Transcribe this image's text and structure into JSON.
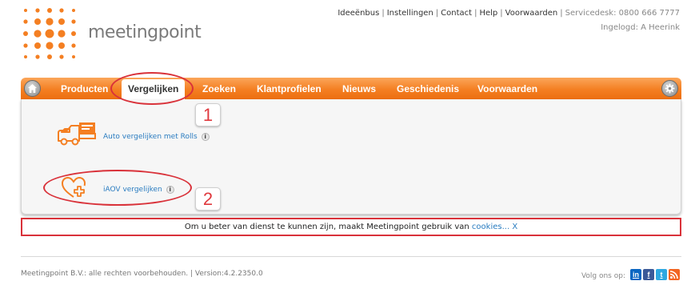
{
  "brand": {
    "name": "meetingpoint",
    "primary_color": "#f47f22",
    "accent_color": "#d9323a",
    "link_color": "#2a7cc0"
  },
  "toplinks": {
    "items": [
      "Ideeënbus",
      "Instellingen",
      "Contact",
      "Help",
      "Voorwaarden"
    ],
    "servicedesk": "Servicedesk: 0800 666 7777",
    "logged_in": "Ingelogd: A Heerink"
  },
  "nav": {
    "tabs": [
      {
        "label": "Producten",
        "active": false
      },
      {
        "label": "Vergelijken",
        "active": true
      },
      {
        "label": "Zoeken",
        "active": false
      },
      {
        "label": "Klantprofielen",
        "active": false
      },
      {
        "label": "Nieuws",
        "active": false
      },
      {
        "label": "Geschiedenis",
        "active": false
      },
      {
        "label": "Voorwaarden",
        "active": false
      }
    ],
    "home_icon": "home-icon",
    "settings_icon": "gear-icon"
  },
  "submenu": {
    "items": [
      {
        "label": "Auto vergelijken met Rolls",
        "icon": "truck-icon",
        "info": "i"
      },
      {
        "label": "iAOV vergelijken",
        "icon": "heart-plus-icon",
        "info": "i"
      }
    ]
  },
  "annotations": {
    "badge_1": "1",
    "badge_2": "2"
  },
  "cookie_bar": {
    "text": "Om u beter van dienst te kunnen zijn, maakt Meetingpoint gebruik van",
    "link": "cookies...",
    "close": "X"
  },
  "footer": {
    "copyright": "Meetingpoint B.V.: alle rechten voorbehouden. | Version:4.2.2350.0",
    "follow_label": "Volg ons op:",
    "social": [
      {
        "icon": "linkedin-icon",
        "glyph": "in",
        "color": "#0a66c2"
      },
      {
        "icon": "facebook-icon",
        "glyph": "f",
        "color": "#3b5998"
      },
      {
        "icon": "twitter-icon",
        "glyph": "t",
        "color": "#2fa8e1"
      },
      {
        "icon": "rss-icon",
        "glyph": "",
        "color": "#f26522"
      }
    ]
  }
}
